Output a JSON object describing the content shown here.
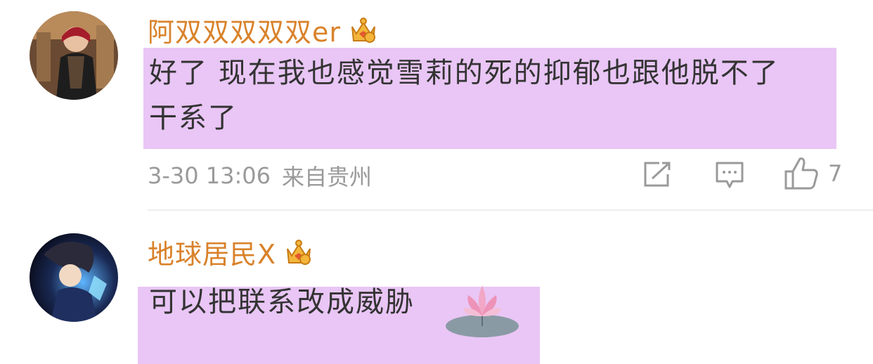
{
  "comments": [
    {
      "username": "阿双双双双双er",
      "text_lines": [
        "好了 现在我也感觉雪莉的死的抑郁也跟他脱不了",
        "干系了"
      ],
      "time": "3-30 13:06",
      "location": "来自贵州",
      "likes": "7",
      "badge_icon": "crown-badge-icon",
      "avatar_icon": "avatar-photo"
    },
    {
      "username": "地球居民X",
      "text_lines": [
        "可以把联系改成威胁"
      ],
      "badge_icon": "crown-badge-icon",
      "avatar_icon": "avatar-anime",
      "sticker_icon": "lotus-sticker-icon"
    }
  ],
  "colors": {
    "username": "#d9822b",
    "highlight": "#e9c6f5",
    "body_text": "#333333",
    "meta_text": "#9a9a9a"
  },
  "actions": {
    "share_icon": "share-icon",
    "reply_icon": "comment-icon",
    "like_icon": "thumbs-up-icon"
  }
}
